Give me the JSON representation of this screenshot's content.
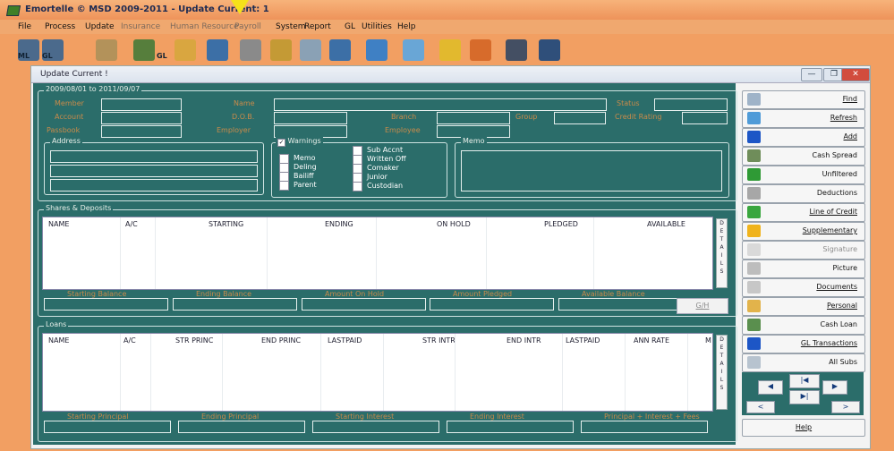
{
  "window": {
    "title": "Emortelle © MSD 2009-2011 - Update Current: 1"
  },
  "menu": [
    "File",
    "Process",
    "Update",
    "Insurance",
    "Human Resource",
    "Payroll",
    "System",
    "Report",
    "GL",
    "Utilities",
    "Help"
  ],
  "menu_disabled": [
    false,
    false,
    false,
    true,
    true,
    true,
    false,
    false,
    false,
    false,
    false
  ],
  "toolbar": {
    "icon_labels": [
      "ML",
      "GL",
      "GL"
    ]
  },
  "child_window": {
    "title": "Update Current !",
    "buttons": [
      "—",
      "❐",
      "✕"
    ]
  },
  "member_panel": {
    "date_range": "2009/08/01 to 2011/09/07",
    "labels": {
      "member": "Member",
      "account": "Account",
      "passbook": "Passbook",
      "name": "Name",
      "dob": "D.O.B.",
      "employer": "Employer",
      "branch": "Branch",
      "employee": "Employee",
      "group": "Group",
      "status": "Status",
      "credit_rating": "Credit Rating"
    },
    "address_title": "Address",
    "warnings": {
      "title": "Warnings",
      "checked": true,
      "left": [
        "Memo",
        "Deling",
        "Bailiff",
        "Parent"
      ],
      "right": [
        "Sub Accnt",
        "Written Off",
        "Comaker",
        "Junior",
        "Custodian"
      ]
    },
    "memo_title": "Memo"
  },
  "shares": {
    "title": "Shares & Deposits",
    "columns": [
      "NAME",
      "A/C",
      "STARTING",
      "ENDING",
      "ON HOLD",
      "PLEDGED",
      "AVAILABLE"
    ],
    "details": "DETAILS",
    "totals": [
      "Starting Balance",
      "Ending Balance",
      "Amount On Hold",
      "Amount Pledged",
      "Available Balance"
    ],
    "gh_button": "G/H"
  },
  "loans": {
    "title": "Loans",
    "columns": [
      "NAME",
      "A/C",
      "STR PRINC",
      "END PRINC",
      "LASTPAID",
      "STR INTR",
      "END INTR",
      "LASTPAID",
      "ANN RATE",
      "M"
    ],
    "details": "DETAILS",
    "totals": [
      "Starting Principal",
      "Ending Principal",
      "Starting Interest",
      "Ending Interest",
      "Principal + Interest + Fees"
    ]
  },
  "side_buttons": [
    {
      "label": "Find",
      "icon": "magnifier-icon",
      "color": "#9fb3c8",
      "underline": true,
      "dim": false
    },
    {
      "label": "Refresh",
      "icon": "refresh-icon",
      "color": "#4f9bd8",
      "underline": true,
      "dim": false
    },
    {
      "label": "Add",
      "icon": "plus-icon",
      "color": "#1d56c6",
      "underline": true,
      "dim": false
    },
    {
      "label": "Cash Spread",
      "icon": "cash-spread-icon",
      "color": "#6f8d5a",
      "underline": false,
      "dim": false
    },
    {
      "label": "Unfiltered",
      "icon": "checkmark-icon",
      "color": "#2f9a35",
      "underline": false,
      "dim": false
    },
    {
      "label": "Deductions",
      "icon": "funnel-icon",
      "color": "#a7a7a7",
      "underline": false,
      "dim": false
    },
    {
      "label": "Line of Credit",
      "icon": "dollar-icon",
      "color": "#39a63e",
      "underline": true,
      "dim": false
    },
    {
      "label": "Supplementary",
      "icon": "star-icon",
      "color": "#f0b31c",
      "underline": true,
      "dim": false
    },
    {
      "label": "Signature",
      "icon": "signature-icon",
      "color": "#d9d9d9",
      "underline": false,
      "dim": true
    },
    {
      "label": "Picture",
      "icon": "camera-icon",
      "color": "#bdbdbd",
      "underline": false,
      "dim": false
    },
    {
      "label": "Documents",
      "icon": "paperclip-icon",
      "color": "#c7c7c7",
      "underline": true,
      "dim": false
    },
    {
      "label": "Personal",
      "icon": "id-card-icon",
      "color": "#e2b34b",
      "underline": true,
      "dim": false
    },
    {
      "label": "Cash Loan",
      "icon": "cash-loan-icon",
      "color": "#5a8f4e",
      "underline": false,
      "dim": false
    },
    {
      "label": "GL Transactions",
      "icon": "plus-icon",
      "color": "#1d56c6",
      "underline": true,
      "dim": false
    },
    {
      "label": "All Subs",
      "icon": "all-subs-icon",
      "color": "#b7c3cf",
      "underline": false,
      "dim": false
    }
  ],
  "nav": {
    "first": "|◀",
    "prev": "◀",
    "next": "▶",
    "last": "▶|",
    "small_prev": "<",
    "small_next": ">"
  },
  "help": "Help"
}
